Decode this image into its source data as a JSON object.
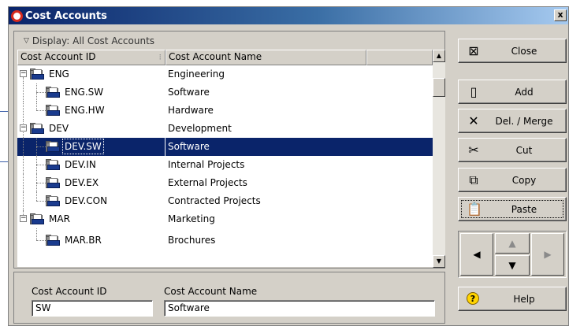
{
  "window": {
    "title": "Cost Accounts",
    "close_glyph": "x"
  },
  "display": {
    "label": "Display: All Cost Accounts"
  },
  "columns": {
    "id": "Cost Account ID",
    "name": "Cost Account Name"
  },
  "rows": [
    {
      "id": "ENG",
      "name": "Engineering",
      "level": 0,
      "expander": "−",
      "selected": false
    },
    {
      "id": "ENG.SW",
      "name": "Software",
      "level": 1,
      "selected": false
    },
    {
      "id": "ENG.HW",
      "name": "Hardware",
      "level": 1,
      "selected": false
    },
    {
      "id": "DEV",
      "name": "Development",
      "level": 0,
      "expander": "−",
      "selected": false
    },
    {
      "id": "DEV.SW",
      "name": "Software",
      "level": 1,
      "selected": true
    },
    {
      "id": "DEV.IN",
      "name": "Internal Projects",
      "level": 1,
      "selected": false
    },
    {
      "id": "DEV.EX",
      "name": "External Projects",
      "level": 1,
      "selected": false
    },
    {
      "id": "DEV.CON",
      "name": "Contracted Projects",
      "level": 1,
      "selected": false
    },
    {
      "id": "MAR",
      "name": "Marketing",
      "level": 0,
      "expander": "−",
      "selected": false
    },
    {
      "id": "MAR.BR",
      "name": "Brochures",
      "level": 1,
      "selected": false
    }
  ],
  "details": {
    "id_label": "Cost Account ID",
    "id_value": "SW",
    "name_label": "Cost Account Name",
    "name_value": "Software"
  },
  "buttons": {
    "close": "Close",
    "add": "Add",
    "delete": "Del. / Merge",
    "cut": "Cut",
    "copy": "Copy",
    "paste": "Paste",
    "help": "Help"
  },
  "icons": {
    "window": "oracle-logo-icon",
    "close": "close-window-icon",
    "add": "new-document-icon",
    "delete": "x-delete-icon",
    "cut": "scissors-icon",
    "copy": "copy-icon",
    "paste": "clipboard-icon",
    "help": "question-mark-icon",
    "nav": [
      "arrow-left-icon",
      "arrow-up-icon",
      "arrow-down-icon",
      "arrow-right-icon"
    ]
  },
  "colors": {
    "title_bar": "#0a246a",
    "selection": "#0a246a",
    "face": "#d4d0c8",
    "folder_front": "#1a3b8e",
    "callout_line": "#3b5ea8"
  }
}
